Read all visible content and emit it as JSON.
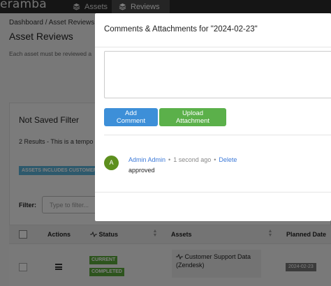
{
  "nav": {
    "brand": "eramba",
    "tabs": [
      {
        "label": "Assets",
        "icon": "layers-icon"
      },
      {
        "label": "Reviews",
        "icon": "layers-icon"
      }
    ]
  },
  "page": {
    "breadcrumb": "Dashboard  /  Asset Reviews  /",
    "title": "Asset Reviews",
    "description": "Each asset must be reviewed a"
  },
  "filter_panel": {
    "title": "Not Saved Filter",
    "results_text": "2 Results - This is a tempo",
    "chip": "ASSETS INCLUDES CUSTOMER",
    "filter_label": "Filter:",
    "filter_placeholder": "Type to filter..."
  },
  "table": {
    "headers": {
      "actions": "Actions",
      "status": "Status",
      "assets": "Assets",
      "planned_date": "Planned Date"
    },
    "row": {
      "status_current": "CURRENT",
      "status_completed": "COMPLETED",
      "asset": "Customer Support Data (Zendesk)",
      "planned_date": "2024-02-23"
    }
  },
  "modal": {
    "title": "Comments & Attachments for \"2024-02-23\"",
    "add_comment_label": "Add Comment",
    "upload_label": "Upload Attachment",
    "comment": {
      "avatar_initial": "A",
      "author": "Admin Admin",
      "time": "1 second ago",
      "delete_label": "Delete",
      "text": "approved"
    }
  },
  "colors": {
    "primary_button": "#3d8fd8",
    "success_button": "#5bb04a",
    "avatar": "#5d8f1e",
    "link": "#3d7ad8"
  }
}
